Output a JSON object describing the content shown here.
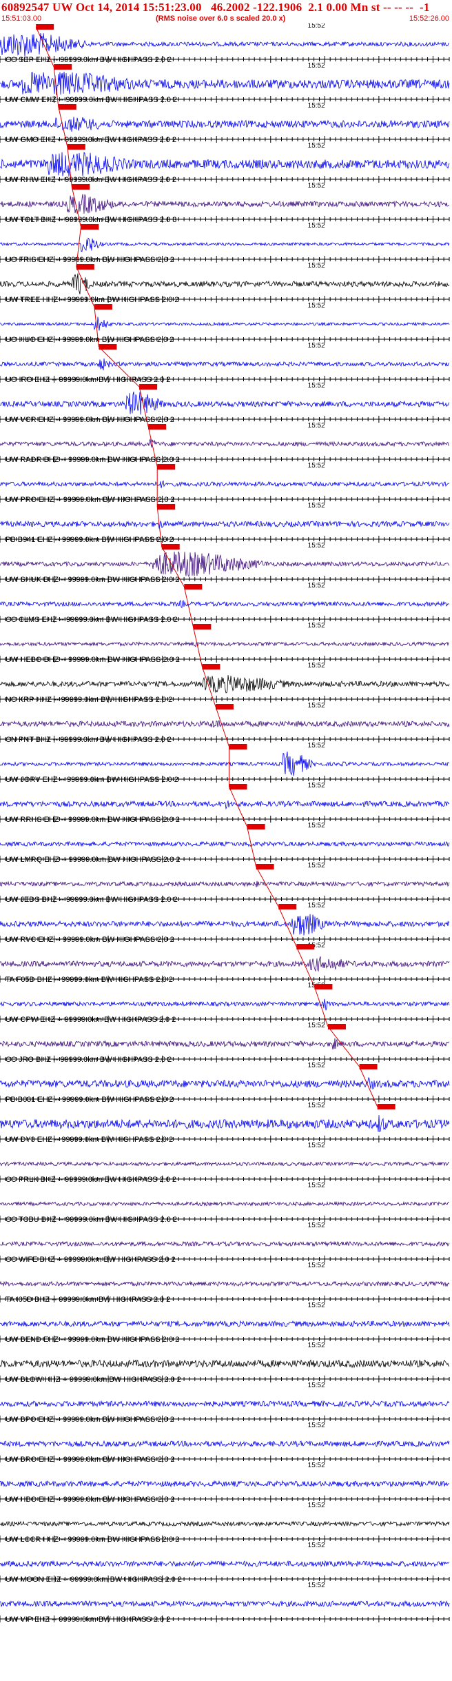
{
  "header": {
    "title": "60892547 UW Oct 14, 2014 15:51:23.00   46.2002 -122.1906  2.1 0.00 Mn st -- -- --  -1",
    "start_time": "15:51:03.00",
    "end_time": "15:52:26.00",
    "note": "(RMS noise over 6.0 s scaled 20.0 x)"
  },
  "minute_label": "15:52",
  "chart_data": {
    "type": "line",
    "time_window": [
      "15:51:03.00",
      "15:52:26.00"
    ],
    "minute_mark": "15:52",
    "traces": [
      {
        "label": "CC SEP EHZ -- 99999.0km BW HIGHPASS 2.0 2",
        "color": "#0000ee",
        "amp": 1.0,
        "quiet": 0.12,
        "burst_start": 0.0,
        "burst_end": 0.5,
        "pick": 0.08
      },
      {
        "label": "UW CMW EHZ -- 99999.0km BW HIGHPASS 2.0 2",
        "color": "#0000ee",
        "amp": 1.0,
        "quiet": 0.25,
        "burst_start": 0.05,
        "burst_end": 0.8,
        "pick": 0.12
      },
      {
        "label": "UW GMO EHZ -- 99999.0km BW HIGHPASS 2.0 2",
        "color": "#0000ee",
        "amp": 0.6,
        "quiet": 0.2,
        "burst_start": 0.12,
        "burst_end": 0.5,
        "pick": 0.13
      },
      {
        "label": "UW RHW EHZ -- 99999.0km BW HIGHPASS 2.0 2",
        "color": "#0000ee",
        "amp": 1.0,
        "quiet": 0.25,
        "burst_start": 0.1,
        "burst_end": 0.65,
        "pick": 0.15
      },
      {
        "label": "UW TOLT BHZ -- 99999.0km BW HIGHPASS 2.0 3",
        "color": "#3a0a7a",
        "amp": 0.8,
        "quiet": 0.15,
        "burst_start": 0.15,
        "burst_end": 0.45,
        "pick": 0.16
      },
      {
        "label": "UO FRIS EHZ -- 99999.0km BW HIGHPASS 2.0 2",
        "color": "#0000ee",
        "amp": 0.7,
        "quiet": 0.08,
        "burst_start": 0.18,
        "burst_end": 0.3,
        "pick": 0.18
      },
      {
        "label": "UW TREE HHZ -- 99999.0km BW HIGHPASS 2.0 2",
        "color": "#000000",
        "amp": 0.9,
        "quiet": 0.15,
        "burst_start": 0.16,
        "burst_end": 0.28,
        "pick": 0.17
      },
      {
        "label": "UO HUO EHZ -- 99999.0km BW HIGHPASS 2.0 2",
        "color": "#0000ee",
        "amp": 0.6,
        "quiet": 0.08,
        "burst_start": 0.21,
        "burst_end": 0.3,
        "pick": 0.21
      },
      {
        "label": "UO IRO EHZ -- 99999.0km BW HIGHPASS 2.0 2",
        "color": "#0000ee",
        "amp": 0.5,
        "quiet": 0.12,
        "burst_start": 0.22,
        "burst_end": 0.3,
        "pick": 0.22
      },
      {
        "label": "UW VCR EHZ -- 99999.0km BW HIGHPASS 2.0 2",
        "color": "#0000ee",
        "amp": 1.0,
        "quiet": 0.15,
        "burst_start": 0.28,
        "burst_end": 0.5,
        "pick": 0.31
      },
      {
        "label": "UW RADR BHZ -- 99999.0km BW HIGHPASS 2.0 2",
        "color": "#3a0a7a",
        "amp": 0.4,
        "quiet": 0.12,
        "burst_start": 0.33,
        "burst_end": 0.4,
        "pick": 0.33
      },
      {
        "label": "UW PRO EHZ -- 99999.0km BW HIGHPASS 2.0 2",
        "color": "#0000ee",
        "amp": 0.4,
        "quiet": 0.12,
        "burst_start": 0.35,
        "burst_end": 0.4,
        "pick": 0.35
      },
      {
        "label": "PB B941 EHZ -- 99999.0km BW HIGHPASS 2.0 2",
        "color": "#0000ee",
        "amp": 0.4,
        "quiet": 0.15,
        "burst_start": 0.35,
        "burst_end": 0.4,
        "pick": 0.35
      },
      {
        "label": "UW SHUK BHZ -- 99999.0km BW HIGHPASS 2.0 2",
        "color": "#3a0a7a",
        "amp": 1.0,
        "quiet": 0.12,
        "burst_start": 0.34,
        "burst_end": 0.98,
        "pick": 0.36
      },
      {
        "label": "CC CLMS EHZ -- 99999.0km BW HIGHPASS 2.0 2",
        "color": "#0000ee",
        "amp": 0.3,
        "quiet": 0.12,
        "burst_start": 0.4,
        "burst_end": 0.45,
        "pick": 0.41
      },
      {
        "label": "UW HEBO BHZ -- 99999.0km BW HIGHPASS 2.0 2",
        "color": "#3a0a7a",
        "amp": 0.3,
        "quiet": 0.1,
        "burst_start": 0.43,
        "burst_end": 0.47,
        "pick": 0.43
      },
      {
        "label": "NC KRP HHZ -- 99999.0km BW HIGHPASS 2.0 2",
        "color": "#000000",
        "amp": 0.7,
        "quiet": 0.15,
        "burst_start": 0.45,
        "burst_end": 1.0,
        "pick": 0.45
      },
      {
        "label": "CN PNT BHZ -- 99999.0km BW HIGHPASS 2.0 2",
        "color": "#3a0a7a",
        "amp": 0.4,
        "quiet": 0.15,
        "burst_start": 0.47,
        "burst_end": 0.55,
        "pick": 0.48
      },
      {
        "label": "UW JORV EHZ -- 99999.0km BW HIGHPASS 2.0 2",
        "color": "#0000ee",
        "amp": 1.0,
        "quiet": 0.1,
        "burst_start": 0.63,
        "burst_end": 0.8,
        "pick": 0.51
      },
      {
        "label": "UW RRHS EHZ -- 99999.0km BW HIGHPASS 2.0 2",
        "color": "#0000ee",
        "amp": 0.4,
        "quiet": 0.15,
        "burst_start": 0.5,
        "burst_end": 0.55,
        "pick": 0.51
      },
      {
        "label": "UW LMRQ EHZ -- 99999.0km BW HIGHPASS 2.0 2",
        "color": "#0000ee",
        "amp": 0.3,
        "quiet": 0.12,
        "burst_start": 0.55,
        "burst_end": 0.6,
        "pick": 0.55
      },
      {
        "label": "UW JEDS BHZ -- 99999.0km BW HIGHPASS 2.0 2",
        "color": "#3a0a7a",
        "amp": 0.3,
        "quiet": 0.12,
        "burst_start": 0.57,
        "burst_end": 0.62,
        "pick": 0.57
      },
      {
        "label": "UW RVC EHZ -- 99999.0km BW HIGHPASS 2.0 2",
        "color": "#0000ee",
        "amp": 1.0,
        "quiet": 0.15,
        "burst_start": 0.65,
        "burst_end": 0.85,
        "pick": 0.62
      },
      {
        "label": "TA F05D BHZ -- 99999.0km BW HIGHPASS 2.0 2",
        "color": "#3a0a7a",
        "amp": 0.6,
        "quiet": 0.15,
        "burst_start": 0.69,
        "burst_end": 0.95,
        "pick": 0.66
      },
      {
        "label": "UW CPW EHZ -- 99999.0km BW HIGHPASS 2.0 2",
        "color": "#0000ee",
        "amp": 0.6,
        "quiet": 0.12,
        "burst_start": 0.72,
        "burst_end": 0.76,
        "pick": 0.7
      },
      {
        "label": "CC JRO BHZ -- 99999.0km BW HIGHPASS 2.0 2",
        "color": "#3a0a7a",
        "amp": 0.5,
        "quiet": 0.15,
        "burst_start": 0.74,
        "burst_end": 0.78,
        "pick": 0.73
      },
      {
        "label": "PB B031 EHZ -- 99999.0km BW HIGHPASS 2.0 2",
        "color": "#0000ee",
        "amp": 0.6,
        "quiet": 0.2,
        "burst_start": 0.82,
        "burst_end": 0.86,
        "pick": 0.8
      },
      {
        "label": "UW DY3 EHZ -- 99999.0km BW HIGHPASS 2.0 2",
        "color": "#0000ee",
        "amp": 0.8,
        "quiet": 0.25,
        "burst_start": 0.84,
        "burst_end": 0.9,
        "pick": 0.84
      },
      {
        "label": "CC PRLK BHZ -- 99999.0km BW HIGHPASS 2.0 2",
        "color": "#3a0a7a",
        "amp": 0.2,
        "quiet": 0.1,
        "burst_start": 0.0,
        "burst_end": 0.0,
        "pick": null
      },
      {
        "label": "CC TCBU BHZ -- 99999.0km BW HIGHPASS 2.0 2",
        "color": "#3a0a7a",
        "amp": 0.2,
        "quiet": 0.1,
        "burst_start": 0.0,
        "burst_end": 0.0,
        "pick": null
      },
      {
        "label": "CC WIFE BHZ -- 99999.0km BW HIGHPASS 2.0 2",
        "color": "#3a0a7a",
        "amp": 0.2,
        "quiet": 0.12,
        "burst_start": 0.0,
        "burst_end": 0.0,
        "pick": null
      },
      {
        "label": "TA I05D BHZ -- 99999.0km BW HIGHPASS 2.0 2",
        "color": "#3a0a7a",
        "amp": 0.2,
        "quiet": 0.12,
        "burst_start": 0.0,
        "burst_end": 0.0,
        "pick": null
      },
      {
        "label": "UW BEND EHZ -- 99999.0km BW HIGHPASS 2.0 2",
        "color": "#0000ee",
        "amp": 0.2,
        "quiet": 0.15,
        "burst_start": 0.0,
        "burst_end": 0.0,
        "pick": null
      },
      {
        "label": "UW BLOW HHZ -- 99999.0km BW HIGHPASS 2.0 2",
        "color": "#000000",
        "amp": 0.3,
        "quiet": 0.2,
        "burst_start": 0.0,
        "burst_end": 0.0,
        "pick": null
      },
      {
        "label": "UW BPO EHZ -- 99999.0km BW HIGHPASS 2.0 2",
        "color": "#0000ee",
        "amp": 0.2,
        "quiet": 0.15,
        "burst_start": 0.0,
        "burst_end": 0.0,
        "pick": null
      },
      {
        "label": "UW BRO EHZ -- 99999.0km BW HIGHPASS 2.0 2",
        "color": "#0000ee",
        "amp": 0.2,
        "quiet": 0.15,
        "burst_start": 0.0,
        "burst_end": 0.0,
        "pick": null
      },
      {
        "label": "UW HBO EHZ -- 99999.0km BW HIGHPASS 2.0 2",
        "color": "#0000ee",
        "amp": 0.2,
        "quiet": 0.15,
        "burst_start": 0.0,
        "burst_end": 0.0,
        "pick": null
      },
      {
        "label": "UW LCCR HHZ -- 99999.0km BW HIGHPASS 2.0 2",
        "color": "#000000",
        "amp": 0.2,
        "quiet": 0.12,
        "burst_start": 0.0,
        "burst_end": 0.0,
        "pick": null
      },
      {
        "label": "UW MOON EHZ -- 99999.0km BW HIGHPASS 2.0 2",
        "color": "#0000ee",
        "amp": 0.2,
        "quiet": 0.15,
        "burst_start": 0.0,
        "burst_end": 0.0,
        "pick": null
      },
      {
        "label": "UW VIP EHZ -- 99999.0km BW HIGHPASS 2.0 2",
        "color": "#0000ee",
        "amp": 0.2,
        "quiet": 0.15,
        "burst_start": 0.0,
        "burst_end": 0.0,
        "pick": null
      }
    ]
  }
}
